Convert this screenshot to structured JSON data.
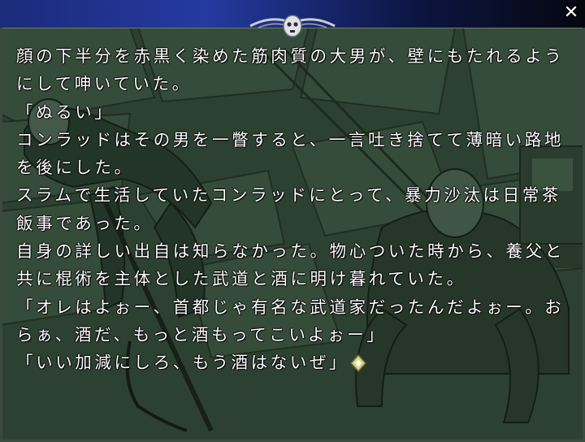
{
  "window": {
    "close_label": "✕"
  },
  "dialogue": {
    "lines": [
      "顔の下半分を赤黒く染めた筋肉質の大男が、壁にもたれるよう",
      "にして呻いていた。",
      "「ぬるい」",
      "コンラッドはその男を一瞥すると、一言吐き捨てて薄暗い路地",
      "を後にした。",
      "スラムで生活していたコンラッドにとって、暴力沙汰は日常茶",
      "飯事であった。",
      "自身の詳しい出自は知らなかった。物心ついた時から、養父と",
      "共に棍術を主体とした武道と酒に明け暮れていた。",
      "「オレはよぉー、首都じゃ有名な武道家だったんだよぉー。お",
      "らぁ、酒だ、もっと酒もってこいよぉー」",
      "「いい加減にしろ、もう酒はないぜ」"
    ]
  },
  "colors": {
    "titlebar_start": "#1c2a7a",
    "titlebar_end": "#05070f",
    "scene_tint": "#3d5540",
    "text": "#ffffff",
    "cursor_accent": "#d8d090"
  },
  "icons": {
    "close": "close-icon",
    "ornament": "skull-ornament-icon",
    "advance": "text-advance-cursor-icon"
  }
}
